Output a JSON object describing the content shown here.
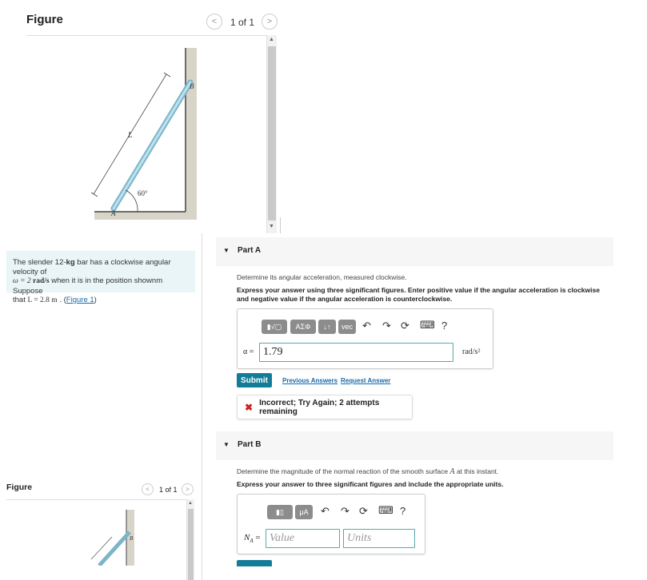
{
  "figure_panel_top": {
    "title": "Figure",
    "pager": "1 of 1",
    "prev_glyph": "<",
    "next_glyph": ">",
    "labels": {
      "b": "B",
      "l": "L",
      "angle": "60°",
      "a": "A"
    }
  },
  "problem": {
    "text_prefix": "The slender 12-",
    "kg": "kg",
    "text_mid1": " bar has a clockwise angular velocity of",
    "omega_line": "ω = 2 ",
    "rads": "rad/s",
    "text_mid2": " when it is in the position shownm Suppose",
    "that": "that ",
    "l_eq": "L = 2.8  m",
    "period": " . (",
    "figure_link": "Figure 1",
    "close": ")"
  },
  "part_a": {
    "header": "Part A",
    "prompt": "Determine its angular acceleration, measured clockwise.",
    "instructions": "Express your answer using three significant figures. Enter positive value if the angular acceleration is clockwise and negative value if the angular acceleration is counterclockwise.",
    "toolbar": {
      "templates": "▮√▢",
      "greek": "ΑΣΦ",
      "arrows": "↓↑",
      "vec": "vec",
      "undo": "↶",
      "redo": "↷",
      "reset": "⟳",
      "keyboard": "⌨",
      "help": "?"
    },
    "var_label": "α =",
    "value": "1.79",
    "units": "rad/s²",
    "submit": "Submit",
    "previous_answers": "Previous Answers",
    "request_answer": "Request Answer",
    "feedback_icon": "✖",
    "feedback": "Incorrect; Try Again; 2 attempts remaining"
  },
  "part_b": {
    "header": "Part B",
    "prompt_prefix": "Determine the magnitude of the normal reaction of the smooth surface ",
    "prompt_var": "A",
    "prompt_suffix": " at this instant.",
    "instructions": "Express your answer to three significant figures and include the appropriate units.",
    "toolbar": {
      "templates": "▮▯",
      "units": "μA",
      "undo": "↶",
      "redo": "↷",
      "reset": "⟳",
      "keyboard": "⌨",
      "help": "?"
    },
    "var_label": "N",
    "var_sub": "A",
    "var_eq": " =",
    "value_placeholder": "Value",
    "units_placeholder": "Units"
  },
  "figure_panel_bottom": {
    "title": "Figure",
    "pager": "1 of 1",
    "prev_glyph": "<",
    "next_glyph": ">",
    "labels": {
      "b": "B"
    }
  },
  "colors": {
    "accent": "#137d98",
    "problem_bg": "#e9f5f6",
    "bar": "#9fd0e0",
    "error": "#cc2222"
  }
}
